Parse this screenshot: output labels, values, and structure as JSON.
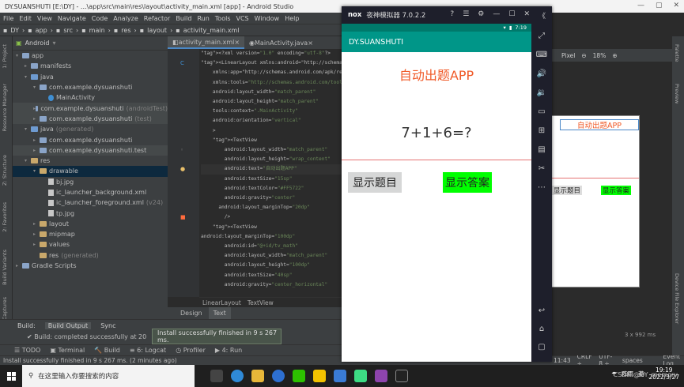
{
  "window": {
    "title": "DY.SUANSHUTI [E:\\DY] - ...\\app\\src\\main\\res\\layout\\activity_main.xml [app] - Android Studio",
    "minimize": "—",
    "maximize": "▢",
    "close": "✕"
  },
  "menu": [
    "File",
    "Edit",
    "View",
    "Navigate",
    "Code",
    "Analyze",
    "Refactor",
    "Build",
    "Run",
    "Tools",
    "VCS",
    "Window",
    "Help"
  ],
  "nav": {
    "crumbs": [
      "DY",
      "app",
      "src",
      "main",
      "res",
      "layout",
      "activity_main.xml"
    ]
  },
  "project": {
    "selector": "Android",
    "tree": [
      {
        "label": "app",
        "indent": 0,
        "kind": "folder",
        "state": "▾"
      },
      {
        "label": "manifests",
        "indent": 1,
        "kind": "folder",
        "state": "▸"
      },
      {
        "label": "java",
        "indent": 1,
        "kind": "java",
        "state": "▾"
      },
      {
        "label": "com.example.dysuanshuti",
        "indent": 2,
        "kind": "pkg",
        "state": "▾"
      },
      {
        "label": "MainActivity",
        "indent": 3,
        "kind": "class",
        "state": ""
      },
      {
        "label": "com.example.dysuanshuti",
        "suffix": "(androidTest)",
        "indent": 2,
        "kind": "pkg",
        "state": "▸",
        "hl": true
      },
      {
        "label": "com.example.dysuanshuti",
        "suffix": "(test)",
        "indent": 2,
        "kind": "pkg",
        "state": "▸",
        "hl": true
      },
      {
        "label": "java",
        "suffix": "(generated)",
        "indent": 1,
        "kind": "java",
        "state": "▾"
      },
      {
        "label": "com.example.dysuanshuti",
        "indent": 2,
        "kind": "pkg",
        "state": "▸"
      },
      {
        "label": "com.example.dysuanshuti.test",
        "indent": 2,
        "kind": "pkg",
        "state": "▸",
        "hl": true
      },
      {
        "label": "res",
        "indent": 1,
        "kind": "res",
        "state": "▾"
      },
      {
        "label": "drawable",
        "indent": 2,
        "kind": "res",
        "state": "▾",
        "sel": true
      },
      {
        "label": "bj.jpg",
        "indent": 3,
        "kind": "file",
        "state": ""
      },
      {
        "label": "ic_launcher_background.xml",
        "indent": 3,
        "kind": "file",
        "state": ""
      },
      {
        "label": "ic_launcher_foreground.xml",
        "suffix": "(v24)",
        "indent": 3,
        "kind": "file",
        "state": ""
      },
      {
        "label": "tp.jpg",
        "indent": 3,
        "kind": "file",
        "state": ""
      },
      {
        "label": "layout",
        "indent": 2,
        "kind": "res",
        "state": "▸"
      },
      {
        "label": "mipmap",
        "indent": 2,
        "kind": "res",
        "state": "▸"
      },
      {
        "label": "values",
        "indent": 2,
        "kind": "res",
        "state": "▸"
      },
      {
        "label": "res",
        "suffix": "(generated)",
        "indent": 2,
        "kind": "res",
        "state": ""
      },
      {
        "label": "Gradle Scripts",
        "indent": 0,
        "kind": "folder",
        "state": "▸"
      }
    ]
  },
  "sidestrip": [
    "1: Project",
    "Resource Manager",
    "Z: Structure",
    "2: Favorites",
    "Build Variants",
    "Layout Captures"
  ],
  "editor": {
    "tabs": [
      "activity_main.xml",
      "MainActivity.java"
    ],
    "lines": [
      "<?xml version=\"1.0\" encoding=\"utf-8\"?>",
      "<LinearLayout xmlns:android=\"http://schemas.android",
      "    xmlns:app=\"http://schemas.android.com/apk/res",
      "    xmlns:tools=\"http://schemas.android.com/tools\"",
      "    android:layout_width=\"match_parent\"",
      "    android:layout_height=\"match_parent\"",
      "    tools:context=\".MainActivity\"",
      "    android:orientation=\"vertical\"",
      "    >",
      "    <TextView",
      "        android:layout_width=\"match_parent\"",
      "        android:layout_height=\"wrap_content\"",
      "        android:text=\"自动出题APP\"",
      "        android:textSize=\"15sp\"",
      "        android:textColor=\"#FF5722\"",
      "        android:gravity=\"center\"",
      "      android:layout_marginTop=\"20dp\"",
      "        />",
      "    <TextView",
      "android:layout_marginTop=\"100dp\"",
      "        android:id=\"@+id/tv_math\"",
      "        android:layout_width=\"match_parent\"",
      "        android:layout_height=\"100dp\"",
      "        android:textSize=\"40sp\"",
      "        android:gravity=\"center_horizontal\""
    ],
    "breadcrumb": [
      "LinearLayout",
      "TextView"
    ],
    "design_tabs": [
      "Design",
      "Text"
    ],
    "active_design_tab": "Text"
  },
  "build": {
    "tabs": [
      "Build:",
      "Build Output",
      "Sync"
    ],
    "row": "✔ Build: completed successfully at 20",
    "toast": "Install successfully finished in 9 s 267 ms."
  },
  "bottom_tools": [
    "☰ TODO",
    "▣ Terminal",
    "🔨 Build",
    "≡ 6: Logcat",
    "◷ Profiler",
    "▶ 4: Run"
  ],
  "status": {
    "text": "Install successfully finished in 9 s 267 ms. (2 minutes ago)",
    "right": [
      "11:43",
      "CRLF ÷",
      "UTF-8 ÷",
      "4 spaces ÷"
    ],
    "event_log": "Event Log"
  },
  "right_pane": {
    "device": "Pixel",
    "zoom": "18%",
    "preview_title": "自动出题APP",
    "preview_btn1": "显示题目",
    "preview_btn2": "显示答案",
    "size": "3 x 992 ms"
  },
  "right_strip": [
    "Palette",
    "Preview",
    "Device File Explorer"
  ],
  "emulator": {
    "brand": "nox",
    "title": "夜神模拟器 7.0.2.2",
    "controls": [
      "?",
      "☰",
      "⚙",
      "—",
      "☐",
      "✕",
      "《"
    ],
    "phone_time": "7:19",
    "app_title": "DY.SUANSHUTI",
    "heading": "自动出题APP",
    "question": "7+1+6=?",
    "btn_show_question": "显示题目",
    "btn_show_answer": "显示答案"
  },
  "taskbar": {
    "search_placeholder": "在这里输入你要搜索的内容",
    "tray_weather": "阵雨",
    "tray_lang": "英",
    "time": "19:19",
    "date": "2022/3/27",
    "watermark": "CSDN @DY_memory"
  },
  "colors": {
    "accent": "#009688",
    "status": "#00796b",
    "title": "#f05a28",
    "answer": "#00ff00"
  }
}
